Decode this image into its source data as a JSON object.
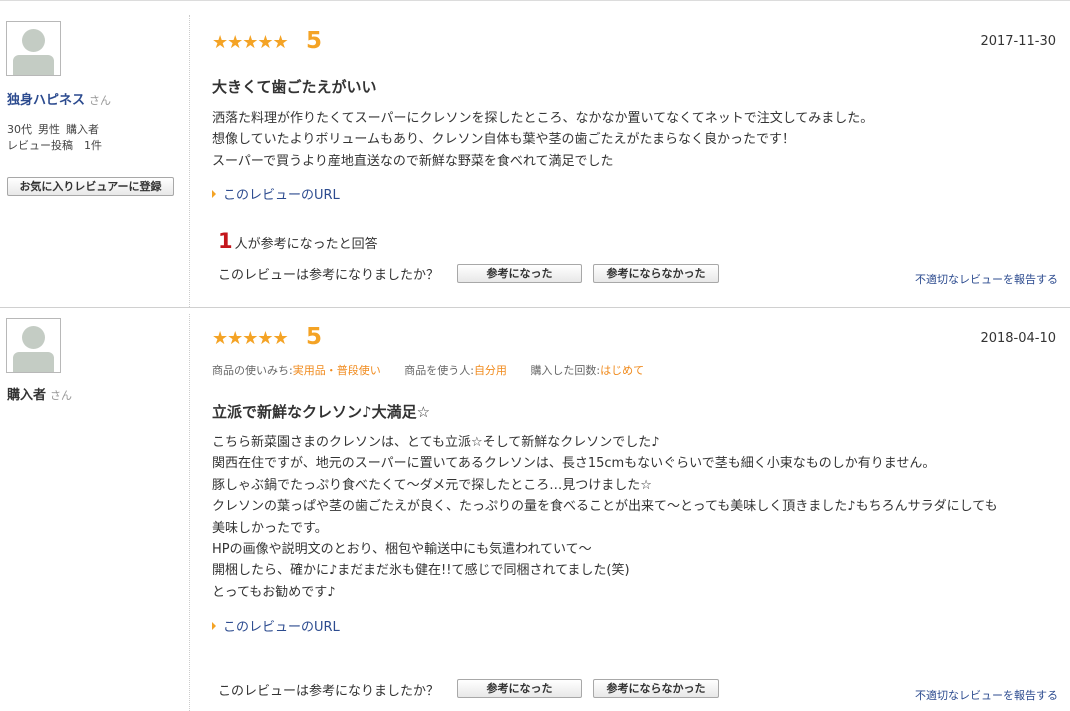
{
  "reviews": [
    {
      "user_name": "独身ハピネス",
      "honorific": "さん",
      "meta": [
        "30代",
        "男性",
        "購入者"
      ],
      "post_count": "レビュー投稿　1件",
      "fav_button": "お気に入りレビュアーに登録",
      "stars": "★★★★★",
      "rating": 5,
      "date": "2017-11-30",
      "title": "大きくて歯ごたえがいい",
      "body": [
        "洒落た料理が作りたくてスーパーにクレソンを探したところ、なかなか置いてなくてネットで注文してみました。",
        "想像していたよりボリュームもあり、クレソン自体も葉や茎の歯ごたえがたまらなく良かったです！",
        "スーパーで買うより産地直送なので新鮮な野菜を食べれて満足でした"
      ],
      "url_link": "このレビューのURL",
      "helpful_count": "1",
      "helpful_text": "人が参考になったと回答",
      "question": "このレビューは参考になりましたか？",
      "helpful_button": "参考になった",
      "not_helpful_button": "参考にならなかった",
      "report_link": "不適切なレビューを報告する"
    },
    {
      "user_name": "購入者",
      "honorific": "さん",
      "stars": "★★★★★",
      "rating": 5,
      "date": "2018-04-10",
      "usage": {
        "purpose_label": "商品の使いみち:",
        "purpose_value": "実用品・普段使い",
        "user_label": "商品を使う人:",
        "user_value": "自分用",
        "count_label": "購入した回数:",
        "count_value": "はじめて"
      },
      "title": "立派で新鮮なクレソン♪大満足☆",
      "body": [
        "こちら新菜園さまのクレソンは、とても立派☆そして新鮮なクレソンでした♪",
        "関西在住ですが、地元のスーパーに置いてあるクレソンは、長さ15cmもないぐらいで茎も細く小束なものしか有りません。",
        "豚しゃぶ鍋でたっぷり食べたくて〜ダメ元で探したところ…見つけました☆",
        "クレソンの葉っぱや茎の歯ごたえが良く、たっぷりの量を食べることが出来て〜とっても美味しく頂きました♪もちろんサラダにしても",
        "美味しかったです。",
        "HPの画像や説明文のとおり、梱包や輸送中にも気遣われていて〜",
        "開梱したら、確かに♪まだまだ氷も健在!!て感じで同梱されてました(笑)",
        "とってもお勧めです♪"
      ],
      "url_link": "このレビューのURL",
      "question": "このレビューは参考になりましたか？",
      "helpful_button": "参考になった",
      "not_helpful_button": "参考にならなかった",
      "report_link": "不適切なレビューを報告する"
    }
  ],
  "colors": {
    "star": "#f4a325",
    "link": "#2c4b8f",
    "count": "#c4161c",
    "usage_value": "#f08a1c"
  },
  "icons": [
    "user-avatar-icon",
    "star-icon",
    "arrow-right-icon"
  ]
}
